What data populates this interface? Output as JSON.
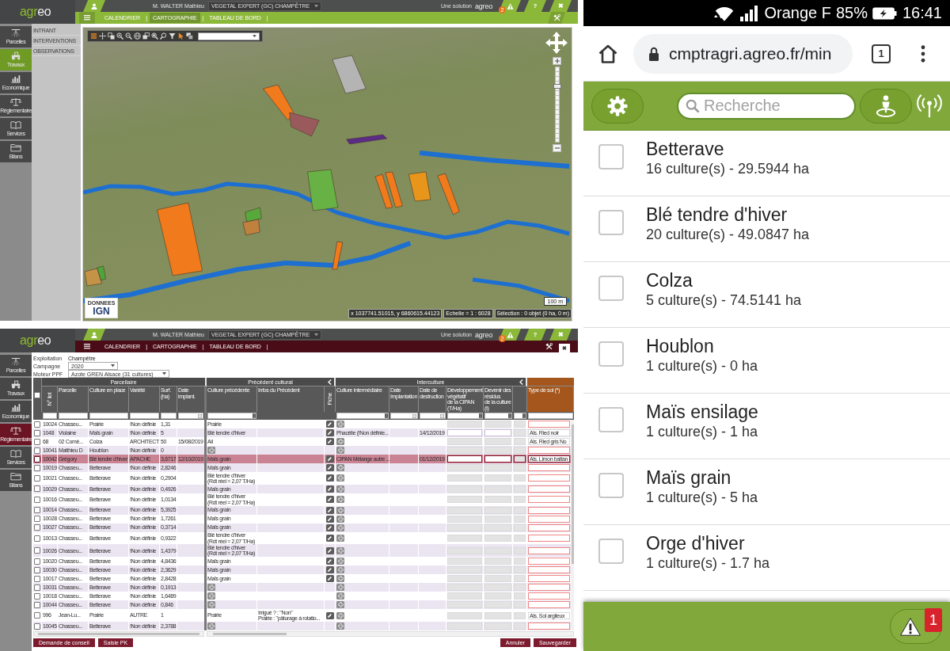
{
  "map_app": {
    "header": {
      "logo": [
        "agr",
        "eo"
      ],
      "user_name": "M. WALTER Mathieu",
      "account": "VEGETAL EXPERT (GC) CHAMPÊTRE",
      "vendor_label": "Une solution",
      "vendor_logo": "agreo",
      "alert_count": "2",
      "help": "?",
      "close": "✖"
    },
    "nav": [
      {
        "label": "CALENDRIER",
        "separator": "|",
        "selected": false
      },
      {
        "label": "CARTOGRAPHIE",
        "separator": "|",
        "selected": true
      },
      {
        "label": "TABLEAU DE BORD",
        "separator": "|",
        "selected": false
      }
    ],
    "sidebar": [
      {
        "label": "Parcelles",
        "selected": false
      },
      {
        "label": "Travaux",
        "selected": true
      },
      {
        "label": "Economique",
        "selected": false
      },
      {
        "label": "Réglementaire",
        "selected": false
      },
      {
        "label": "Services",
        "selected": false
      },
      {
        "label": "Bilans",
        "selected": false
      }
    ],
    "submenu": [
      {
        "label": "INTRANT"
      },
      {
        "label": "INTERVENTIONS"
      },
      {
        "label": "OBSERVATIONS"
      }
    ],
    "map": {
      "parcels": [
        {
          "color": "#f07a1c"
        },
        {
          "color": "#9a5a5c"
        },
        {
          "color": "#b4b4b4"
        },
        {
          "color": "#5b2b86"
        },
        {
          "color": "#68b144"
        },
        {
          "color": "#f07a1c"
        },
        {
          "color": "#f07a1c"
        },
        {
          "color": "#e8951c"
        },
        {
          "color": "#f07a1c"
        },
        {
          "color": "#f07a1c"
        },
        {
          "color": "#58a83c"
        },
        {
          "color": "#c0803e"
        },
        {
          "color": "#f07a1c"
        },
        {
          "color": "#c59347"
        },
        {
          "color": "#4fa53a"
        }
      ],
      "zoom": {
        "level": 0.76
      },
      "attribution": [
        "DONNEES",
        "IGN"
      ],
      "coordinates": "x 1037741.51015, y 6860615.44123",
      "scale": "Echelle = 1 : 6028",
      "selection": "Sélection : 0 objet (0 ha, 0 m)",
      "scale_bar": "100 m"
    }
  },
  "table_app": {
    "header": {
      "logo": [
        "agr",
        "eo"
      ],
      "user_name": "M. WALTER Mathieu",
      "account": "VEGETAL EXPERT (GC) CHAMPÊTRE",
      "vendor_label": "Une solution",
      "vendor_logo": "agreo",
      "alert_count": "2",
      "help": "?",
      "close": "✖"
    },
    "nav": [
      {
        "label": "CALENDRIER",
        "separator": "|",
        "selected": false
      },
      {
        "label": "CARTOGRAPHIE",
        "separator": "|",
        "selected": false
      },
      {
        "label": "TABLEAU DE BORD",
        "separator": "|",
        "selected": false
      }
    ],
    "sidebar": [
      {
        "label": "Parcelles",
        "selected": false
      },
      {
        "label": "Travaux",
        "selected": false
      },
      {
        "label": "Economique",
        "selected": false
      },
      {
        "label": "Réglementaire",
        "selected": true
      },
      {
        "label": "Services",
        "selected": false
      },
      {
        "label": "Bilans",
        "selected": false
      }
    ],
    "dialog_close": "✖",
    "form": [
      {
        "label": "Exploitation",
        "value": "Champêtre",
        "kind": "text"
      },
      {
        "label": "Campagne",
        "value": "2020",
        "kind": "select"
      },
      {
        "label": "Moteur PPF",
        "value": "Azote GREN Alsace (31 cultures)",
        "kind": "select"
      }
    ],
    "table": {
      "select_all": {
        "checked": false
      },
      "groups": [
        {
          "label": "Parcellaire",
          "collapsible": false,
          "highlighted": false,
          "columns": [
            {
              "label": "N° ilot",
              "kind": "text"
            },
            {
              "label": "Parcelle",
              "kind": "text"
            },
            {
              "label": "Culture en place",
              "kind": "text"
            },
            {
              "label": "Variété",
              "kind": "text"
            },
            {
              "label": "Surf.\n(ha)",
              "kind": "text"
            },
            {
              "label": "Date\nimplant.",
              "kind": "date"
            }
          ]
        },
        {
          "label": "Précédent cultural",
          "collapsible": true,
          "highlighted": false,
          "columns": [
            {
              "label": "Culture précédente",
              "kind": "list"
            },
            {
              "label": "Infos du Précédent"
            },
            {
              "label": "Fiche"
            }
          ]
        },
        {
          "label": "Interculture",
          "collapsible": true,
          "highlighted": false,
          "columns": [
            {
              "label": "Culture intermédiaire",
              "kind": "list"
            },
            {
              "label": "Date\nImplantation",
              "kind": "date"
            },
            {
              "label": "Date de\ndestruction",
              "kind": "date"
            },
            {
              "label": "Développement végétatif\nde la CIPAN (T/Ha)",
              "kind": "list"
            },
            {
              "label": "Devenir des résidus\nde la culture (I)",
              "kind": "list"
            },
            {
              "kind": "list"
            }
          ]
        },
        {
          "collapsible": false,
          "highlighted": true,
          "columns": [
            {
              "label": "Type de sol (*)",
              "kind": "text"
            }
          ]
        }
      ],
      "rows": [
        {
          "ilot": "10024",
          "parcel": "Chasseu...",
          "crop": "Prairie",
          "variety": "!Non définie",
          "area": "1,31",
          "previous_crop": "Prairie",
          "cipan_editable": false,
          "selected": false,
          "checked": false
        },
        {
          "ilot": "1048",
          "parcel": "Violaine",
          "crop": "Maïs grain",
          "variety": "!Non définie",
          "area": "5",
          "previous_crop": "Blé tendre d'hiver",
          "intermediate_crop": "Phacélie (!Non définie...",
          "destruction_date": "14/12/2019",
          "cipan_editable": true,
          "soil": "Als. Ried noir",
          "selected": false,
          "checked": false
        },
        {
          "ilot": "68",
          "parcel": "02 Comé...",
          "crop": "Colza",
          "variety": "ARCHITECT",
          "area": "50",
          "date": "15/08/2019",
          "previous_crop": "Ail",
          "cipan_editable": false,
          "soil": "Als. Ried gris No",
          "selected": false,
          "checked": false
        },
        {
          "ilot": "10041",
          "parcel": "Matthieu D",
          "crop": "Houblon",
          "variety": "!Non définie",
          "area": "0",
          "cipan_editable": false,
          "selected": false,
          "checked": false
        },
        {
          "ilot": "10042",
          "parcel": "Grégory",
          "crop": "Blé tendre d'hiver",
          "variety": "APACHE",
          "area": "3,6717",
          "date": "12/10/2019",
          "previous_crop": "Maïs grain",
          "intermediate_crop": "CIPAN Mélange autre ...",
          "destruction_date": "01/12/2019",
          "cipan_editable": true,
          "soil": "Als. Limon battan",
          "selected": true,
          "checked": false
        },
        {
          "ilot": "10019",
          "parcel": "Chasseu...",
          "crop": "Betterave",
          "variety": "!Non définie",
          "area": "2,8246",
          "previous_crop": "Maïs grain",
          "cipan_editable": false,
          "selected": false,
          "checked": false
        },
        {
          "ilot": "10021",
          "parcel": "Chasseu...",
          "crop": "Betterave",
          "variety": "!Non définie",
          "area": "0,2904",
          "previous_crop": "Blé tendre d'hiver\n(Rdt réel = 2,07 T/Ha)",
          "cipan_editable": false,
          "selected": false,
          "checked": false
        },
        {
          "ilot": "10029",
          "parcel": "Chasseu...",
          "crop": "Betterave",
          "variety": "!Non définie",
          "area": "0,4926",
          "previous_crop": "Maïs grain",
          "cipan_editable": false,
          "selected": false,
          "checked": false
        },
        {
          "ilot": "10016",
          "parcel": "Chasseu...",
          "crop": "Betterave",
          "variety": "!Non définie",
          "area": "1,0134",
          "previous_crop": "Blé tendre d'hiver\n(Rdt réel = 2,07 T/Ha)",
          "cipan_editable": false,
          "selected": false,
          "checked": false
        },
        {
          "ilot": "10014",
          "parcel": "Chasseu...",
          "crop": "Betterave",
          "variety": "!Non définie",
          "area": "5,3925",
          "previous_crop": "Maïs grain",
          "cipan_editable": false,
          "selected": false,
          "checked": false
        },
        {
          "ilot": "10028",
          "parcel": "Chasseu...",
          "crop": "Betterave",
          "variety": "!Non définie",
          "area": "1,7261",
          "previous_crop": "Maïs grain",
          "cipan_editable": false,
          "selected": false,
          "checked": false
        },
        {
          "ilot": "10027",
          "parcel": "Chasseu...",
          "crop": "Betterave",
          "variety": "!Non définie",
          "area": "0,3714",
          "previous_crop": "Maïs grain",
          "cipan_editable": false,
          "selected": false,
          "checked": false
        },
        {
          "ilot": "10013",
          "parcel": "Chasseu...",
          "crop": "Betterave",
          "variety": "!Non définie",
          "area": "0,9322",
          "previous_crop": "Blé tendre d'hiver\n(Rdt réel = 2,07 T/Ha)",
          "cipan_editable": false,
          "selected": false,
          "checked": false
        },
        {
          "ilot": "10026",
          "parcel": "Chasseu...",
          "crop": "Betterave",
          "variety": "!Non définie",
          "area": "1,4379",
          "previous_crop": "Blé tendre d'hiver\n(Rdt réel = 2,07 T/Ha)",
          "cipan_editable": false,
          "selected": false,
          "checked": false
        },
        {
          "ilot": "10020",
          "parcel": "Chasseu...",
          "crop": "Betterave",
          "variety": "!Non définie",
          "area": "4,8436",
          "previous_crop": "Maïs grain",
          "cipan_editable": false,
          "selected": false,
          "checked": false
        },
        {
          "ilot": "10030",
          "parcel": "Chasseu...",
          "crop": "Betterave",
          "variety": "!Non définie",
          "area": "2,3629",
          "previous_crop": "Maïs grain",
          "cipan_editable": false,
          "selected": false,
          "checked": false
        },
        {
          "ilot": "10017",
          "parcel": "Chasseu...",
          "crop": "Betterave",
          "variety": "!Non définie",
          "area": "2,8428",
          "previous_crop": "Maïs grain",
          "cipan_editable": false,
          "selected": false,
          "checked": false
        },
        {
          "ilot": "10031",
          "parcel": "Chasseu...",
          "crop": "Betterave",
          "variety": "!Non définie",
          "area": "0,1913",
          "cipan_editable": false,
          "selected": false,
          "checked": false
        },
        {
          "ilot": "10018",
          "parcel": "Chasseu...",
          "crop": "Betterave",
          "variety": "!Non définie",
          "area": "1,6489",
          "cipan_editable": false,
          "selected": false,
          "checked": false
        },
        {
          "ilot": "10044",
          "parcel": "Chasseu...",
          "crop": "Betterave",
          "variety": "!Non définie",
          "area": "0,846",
          "cipan_editable": false,
          "selected": false,
          "checked": false
        },
        {
          "ilot": "996",
          "parcel": "Jean-Lu...",
          "crop": "Prairie",
          "variety": "AUTRE",
          "area": "1",
          "previous_crop": "Prairie",
          "previous_info": "Irrigué ? : \"Non\"\nPrairie : \"pâturage à rotatio...",
          "cipan_editable": false,
          "soil": "Als. Sol argileux",
          "selected": false,
          "checked": false
        },
        {
          "ilot": "10045",
          "parcel": "Chasseu...",
          "crop": "Betterave",
          "variety": "!Non définie",
          "area": "2,3788",
          "cipan_editable": false,
          "selected": false,
          "checked": false
        }
      ]
    },
    "actions_left": [
      "Demande de conseil",
      "Saisie PK"
    ],
    "actions_right": [
      "Annuler",
      "Sauvegarder"
    ]
  },
  "phone": {
    "status_bar": {
      "carrier": "Orange F",
      "battery": "85%",
      "time": "16:41"
    },
    "browser": {
      "url": "cmptragri.agreo.fr/min",
      "tab_count": "1"
    },
    "search": {
      "placeholder": "Recherche"
    },
    "crops": [
      {
        "name": "Betterave",
        "summary": "16 culture(s) - 29.5944 ha",
        "checked": false
      },
      {
        "name": "Blé tendre d'hiver",
        "summary": "20 culture(s) - 49.0847 ha",
        "checked": false
      },
      {
        "name": "Colza",
        "summary": "5 culture(s) - 74.5141 ha",
        "checked": false
      },
      {
        "name": "Houblon",
        "summary": "1 culture(s) - 0 ha",
        "checked": false
      },
      {
        "name": "Maïs ensilage",
        "summary": "1 culture(s) - 1 ha",
        "checked": false
      },
      {
        "name": "Maïs grain",
        "summary": "1 culture(s) - 5 ha",
        "checked": false
      },
      {
        "name": "Orge d'hiver",
        "summary": "1 culture(s) - 1.7 ha",
        "checked": false
      }
    ],
    "alert_count": "1"
  }
}
